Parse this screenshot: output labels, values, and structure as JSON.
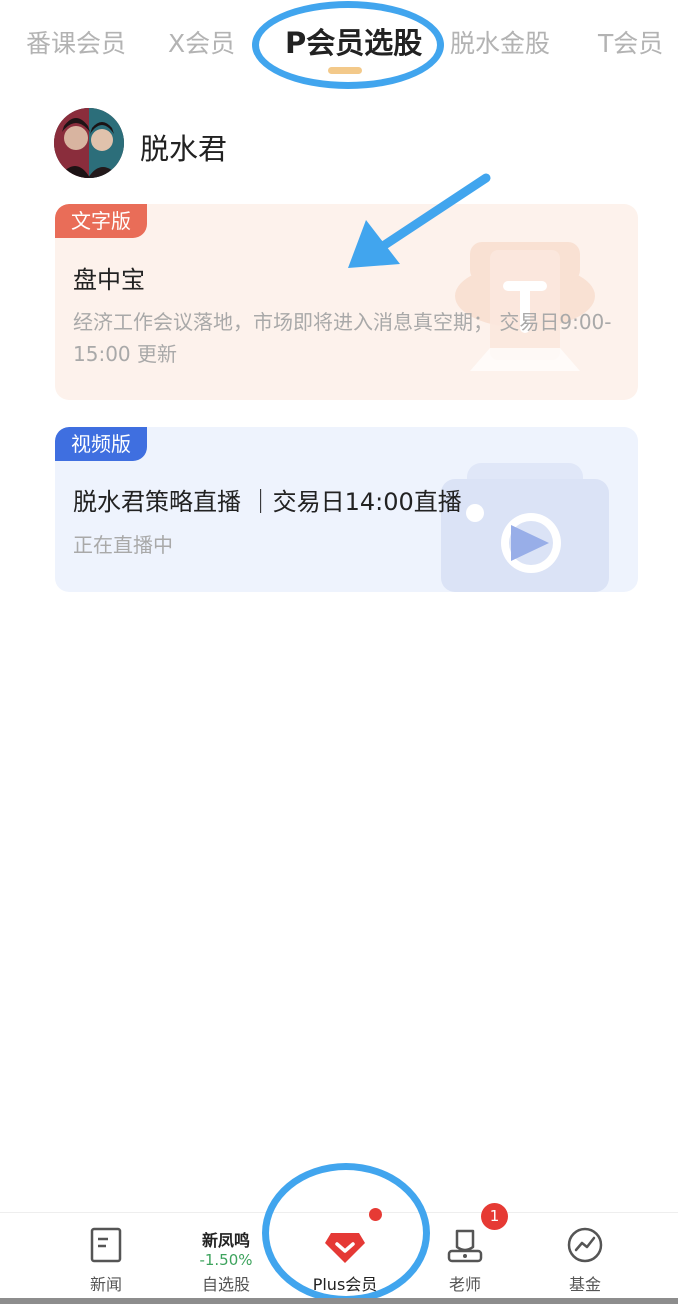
{
  "tabs": [
    {
      "label": "番课会员"
    },
    {
      "label": "X会员"
    },
    {
      "label": "P会员选股"
    },
    {
      "label": "脱水金股"
    },
    {
      "label": "T会员"
    }
  ],
  "active_tab": "P会员选股",
  "author": {
    "name": "脱水君"
  },
  "cards": [
    {
      "badge": "文字版",
      "title": "盘中宝",
      "description": "经济工作会议落地，市场即将进入消息真空期； 交易日9:00-15:00 更新",
      "icon": "text-document-icon"
    },
    {
      "badge": "视频版",
      "title": "脱水君策略直播 ｜交易日14:00直播",
      "description": "正在直播中",
      "icon": "video-play-icon"
    }
  ],
  "bottom_nav": [
    {
      "label": "新闻",
      "icon": "news-icon"
    },
    {
      "label": "自选股",
      "stock_name": "新凤鸣",
      "stock_change": "-1.50%"
    },
    {
      "label": "Plus会员",
      "icon": "diamond-icon",
      "has_dot": true
    },
    {
      "label": "老师",
      "icon": "teacher-icon",
      "badge": "1"
    },
    {
      "label": "基金",
      "icon": "fund-chart-icon"
    }
  ],
  "colors": {
    "accent_annotation": "#41a5ee",
    "badge_text": "#e96d58",
    "badge_video": "#3f6fe0",
    "tab_underline": "#f3c98a",
    "notification": "#e63a34",
    "stock_change": "#3da35d"
  }
}
